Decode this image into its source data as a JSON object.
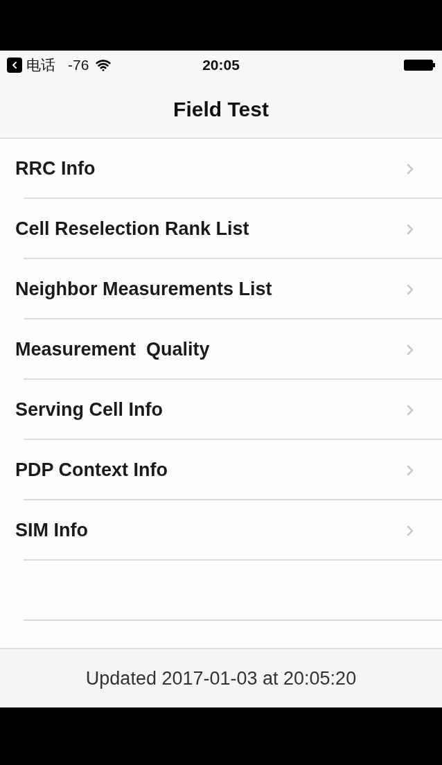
{
  "status_bar": {
    "back_app": "电话",
    "signal": "-76",
    "time": "20:05"
  },
  "nav": {
    "title": "Field Test"
  },
  "items": [
    {
      "label": "RRC Info"
    },
    {
      "label": "Cell Reselection Rank List"
    },
    {
      "label": "Neighbor Measurements List"
    },
    {
      "label": "Measurement  Quality"
    },
    {
      "label": "Serving Cell Info"
    },
    {
      "label": "PDP Context Info"
    },
    {
      "label": "SIM Info"
    }
  ],
  "footer": {
    "text": "Updated 2017-01-03 at 20:05:20"
  }
}
